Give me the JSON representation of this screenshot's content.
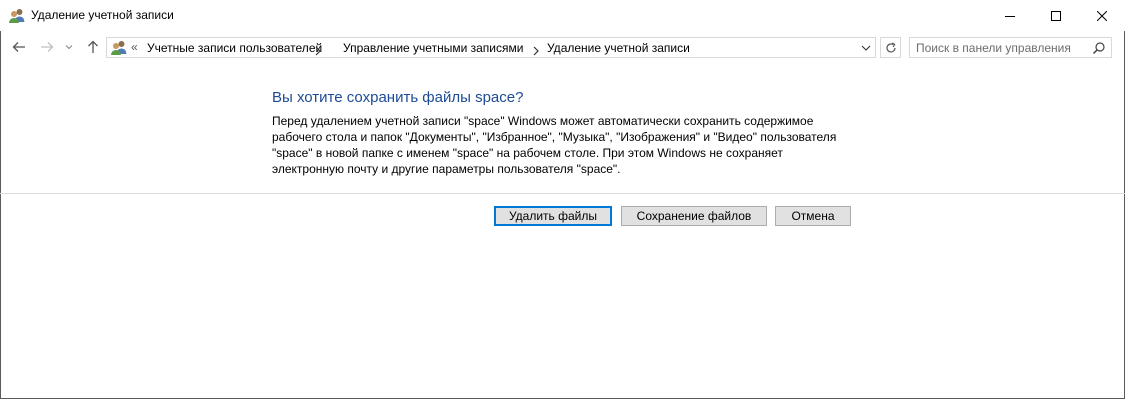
{
  "window": {
    "title": "Удаление учетной записи",
    "icon": "users-icon"
  },
  "address_bar": {
    "overflow_chevron": "«",
    "breadcrumbs": [
      "Учетные записи пользователей",
      "Управление учетными записями",
      "Удаление учетной записи"
    ]
  },
  "search": {
    "placeholder": "Поиск в панели управления"
  },
  "content": {
    "heading": "Вы хотите сохранить файлы space?",
    "description": "Перед удалением учетной записи \"space\" Windows может автоматически сохранить содержимое\nрабочего стола и папок \"Документы\", \"Избранное\", \"Музыка\", \"Изображения\" и \"Видео\" пользователя\n\"space\" в новой папке с именем \"space\" на рабочем столе. При этом Windows не сохраняет\nэлектронную почту и другие параметры пользователя \"space\"."
  },
  "buttons": {
    "delete_files": "Удалить файлы",
    "keep_files": "Сохранение файлов",
    "cancel": "Отмена"
  },
  "colors": {
    "heading": "#1e4b96",
    "default_button_border": "#0078d7",
    "button_face": "#e1e1e1"
  }
}
